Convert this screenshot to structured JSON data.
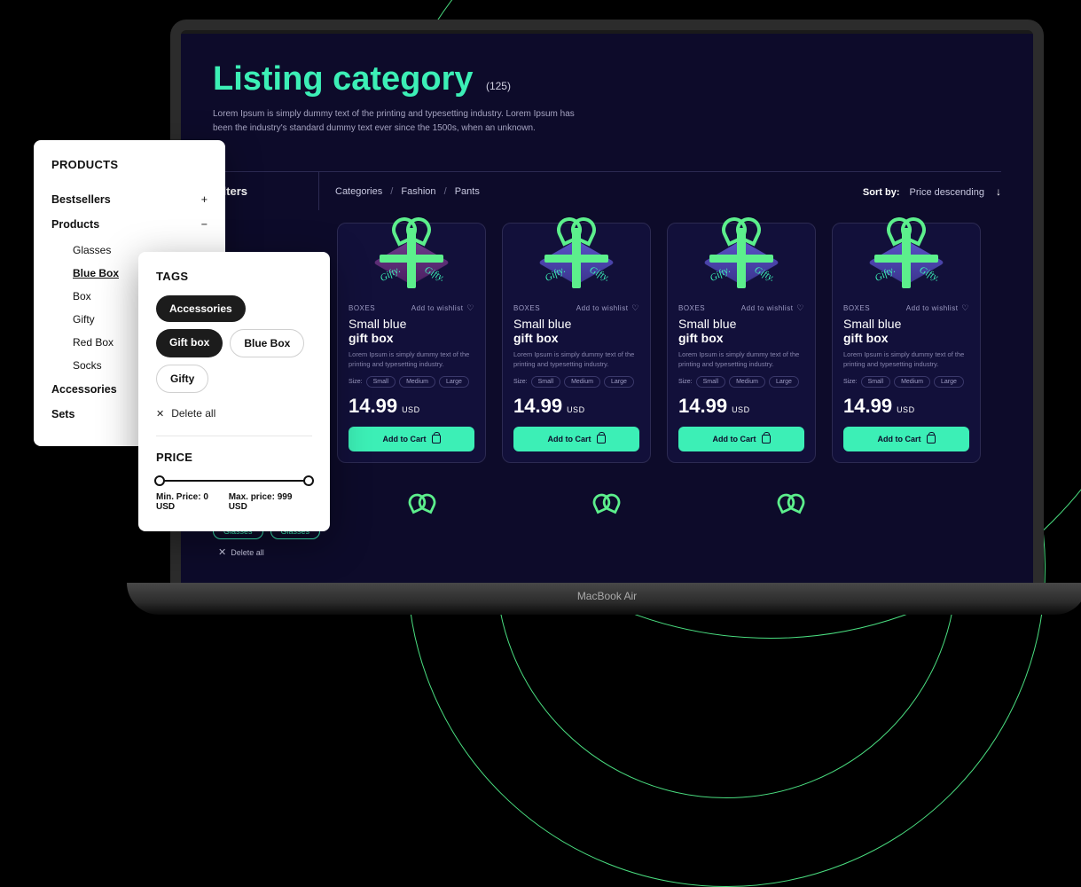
{
  "header": {
    "title": "Listing category",
    "count": "(125)",
    "description": "Lorem Ipsum is simply dummy text of the printing and typesetting industry. Lorem Ipsum has been the industry's standard dummy text ever since the 1500s, when an unknown."
  },
  "toolbar": {
    "filters_label": "Filters",
    "breadcrumb": {
      "a": "Categories",
      "b": "Fashion",
      "c": "Pants"
    },
    "sort_label": "Sort by:",
    "sort_value": "Price descending"
  },
  "product": {
    "category": "BOXES",
    "wishlist": "Add to wishlist",
    "title1": "Small blue",
    "title2": "gift box",
    "desc": "Lorem Ipsum is simply dummy text of the printing and typesetting industry.",
    "size_label": "Size:",
    "sizes": {
      "s": "Small",
      "m": "Medium",
      "l": "Large"
    },
    "price": "14.99",
    "currency": "USD",
    "add_to_cart": "Add to Cart",
    "brand": "Gifty."
  },
  "under_chips": {
    "chip1": "Glasses",
    "chip2": "Glasses",
    "delete": "Delete all"
  },
  "products_panel": {
    "title": "PRODUCTS",
    "bestsellers": "Bestsellers",
    "products": "Products",
    "sub": {
      "glasses": "Glasses",
      "bluebox": "Blue Box",
      "box": "Box",
      "gifty": "Gifty",
      "redbox": "Red Box",
      "socks": "Socks"
    },
    "accessories": "Accessories",
    "sets": "Sets"
  },
  "tags_panel": {
    "title": "TAGS",
    "accessories": "Accessories",
    "giftbox": "Gift box",
    "bluebox": "Blue Box",
    "gifty": "Gifty",
    "delete": "Delete all",
    "price_title": "PRICE",
    "min_label": "Min. Price: 0 USD",
    "max_label": "Max. price: 999 USD"
  },
  "laptop_label": "MacBook Air"
}
